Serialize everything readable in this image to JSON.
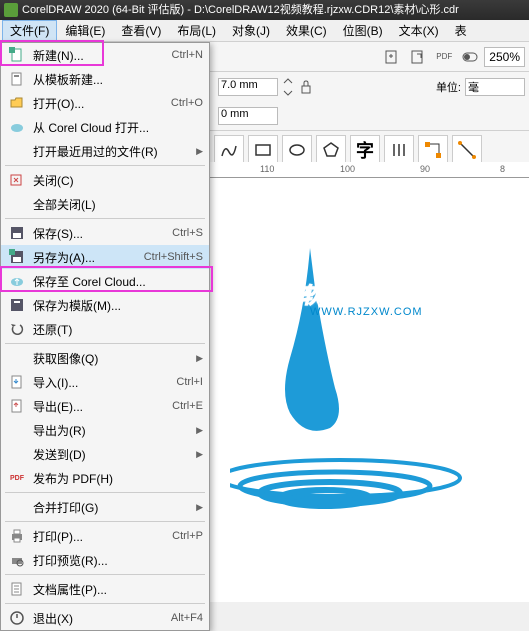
{
  "titlebar": {
    "text": "CorelDRAW 2020 (64-Bit 评估版) - D:\\CorelDRAW12视频教程.rjzxw.CDR12\\素材\\心形.cdr"
  },
  "menubar": {
    "items": [
      {
        "label": "文件(F)",
        "active": true
      },
      {
        "label": "编辑(E)"
      },
      {
        "label": "查看(V)"
      },
      {
        "label": "布局(L)"
      },
      {
        "label": "对象(J)"
      },
      {
        "label": "效果(C)"
      },
      {
        "label": "位图(B)"
      },
      {
        "label": "文本(X)"
      },
      {
        "label": "表"
      }
    ]
  },
  "toolbar": {
    "zoom": "250%"
  },
  "properties": {
    "width": "7.0 mm",
    "height": "0 mm",
    "unit_label": "单位:",
    "unit_value": "毫"
  },
  "ruler": {
    "ticks": [
      "110",
      "100",
      "90",
      "8"
    ]
  },
  "dropdown": {
    "items": [
      {
        "icon": "new",
        "label": "新建(N)...",
        "shortcut": "Ctrl+N"
      },
      {
        "icon": "template",
        "label": "从模板新建..."
      },
      {
        "icon": "open",
        "label": "打开(O)...",
        "shortcut": "Ctrl+O"
      },
      {
        "icon": "cloud-open",
        "label": "从 Corel Cloud 打开..."
      },
      {
        "icon": "recent",
        "label": "打开最近用过的文件(R)",
        "arrow": true
      },
      {
        "sep": true
      },
      {
        "icon": "close",
        "label": "关闭(C)"
      },
      {
        "icon": "",
        "label": "全部关闭(L)"
      },
      {
        "sep": true
      },
      {
        "icon": "save",
        "label": "保存(S)...",
        "shortcut": "Ctrl+S"
      },
      {
        "icon": "saveas",
        "label": "另存为(A)...",
        "shortcut": "Ctrl+Shift+S",
        "highlighted": true
      },
      {
        "icon": "cloud-save",
        "label": "保存至 Corel Cloud..."
      },
      {
        "icon": "save-template",
        "label": "保存为模版(M)..."
      },
      {
        "icon": "revert",
        "label": "还原(T)"
      },
      {
        "sep": true
      },
      {
        "icon": "",
        "label": "获取图像(Q)",
        "arrow": true
      },
      {
        "icon": "import",
        "label": "导入(I)...",
        "shortcut": "Ctrl+I"
      },
      {
        "icon": "export",
        "label": "导出(E)...",
        "shortcut": "Ctrl+E"
      },
      {
        "icon": "",
        "label": "导出为(R)",
        "arrow": true
      },
      {
        "icon": "",
        "label": "发送到(D)",
        "arrow": true
      },
      {
        "icon": "pdf",
        "label": "发布为 PDF(H)"
      },
      {
        "sep": true
      },
      {
        "icon": "",
        "label": "合并打印(G)",
        "arrow": true
      },
      {
        "sep": true
      },
      {
        "icon": "print",
        "label": "打印(P)...",
        "shortcut": "Ctrl+P"
      },
      {
        "icon": "print-preview",
        "label": "打印预览(R)..."
      },
      {
        "sep": true
      },
      {
        "icon": "properties",
        "label": "文档属性(P)..."
      },
      {
        "sep": true
      },
      {
        "icon": "exit",
        "label": "退出(X)",
        "shortcut": "Alt+F4"
      }
    ]
  },
  "canvas": {
    "logo_text": "软件自学网",
    "logo_url": "WWW.RJZXW.COM"
  }
}
